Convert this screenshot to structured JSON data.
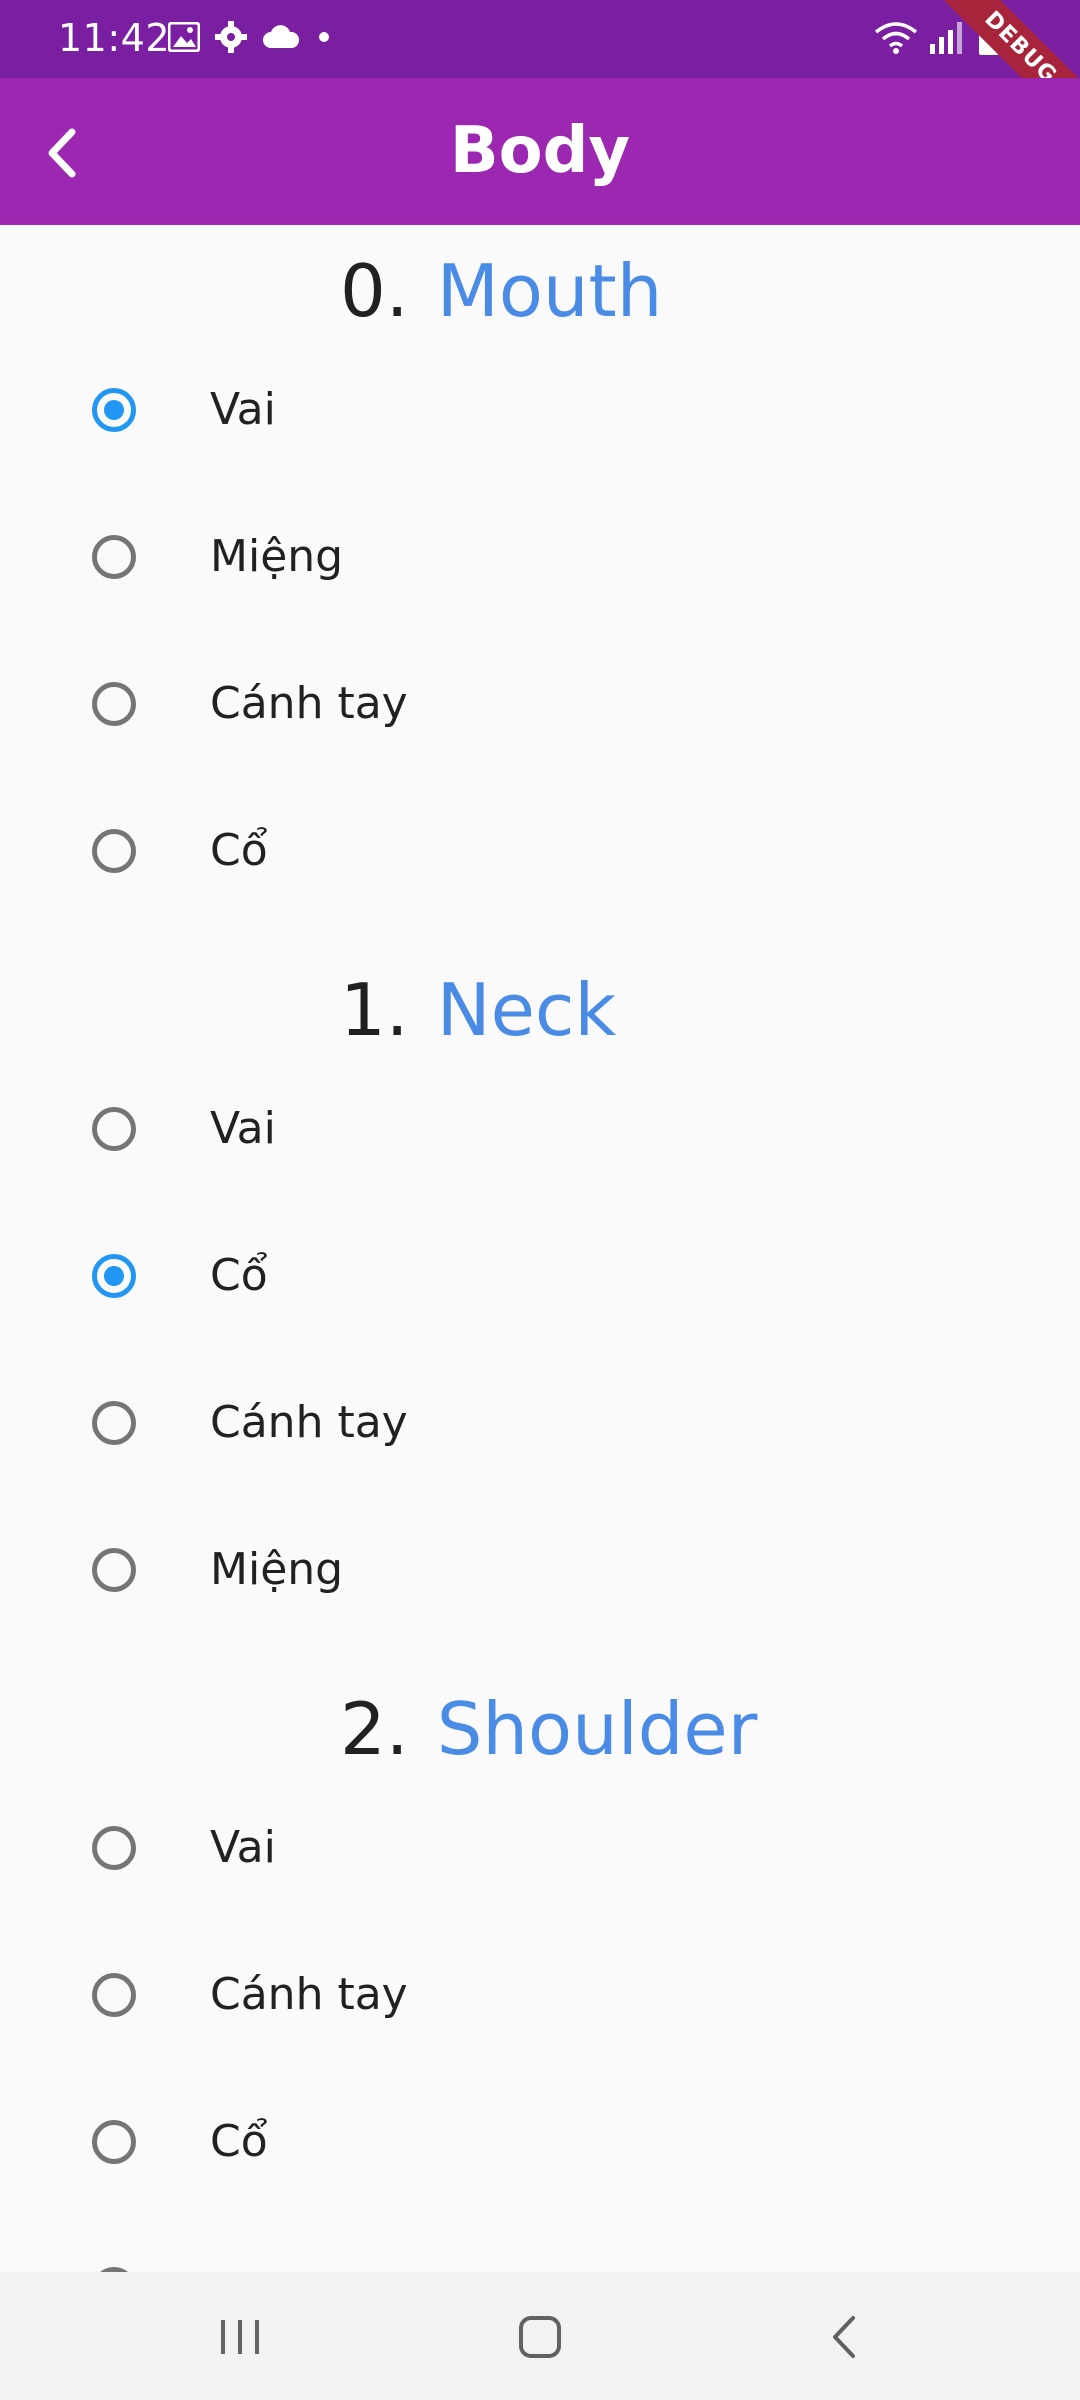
{
  "status_bar": {
    "time": "11:42",
    "left_icons": [
      "image-icon",
      "gear-icon",
      "cloud-icon",
      "dot-icon"
    ],
    "right_icons": [
      "wifi-icon",
      "signal-icon",
      "battery-icon"
    ],
    "debug_label": "DEBUG"
  },
  "app_bar": {
    "title": "Body",
    "back_icon": "back-arrow-icon"
  },
  "questions": [
    {
      "number": "0.",
      "word": "Mouth",
      "options": [
        {
          "label": "Vai",
          "selected": true
        },
        {
          "label": "Miệng",
          "selected": false
        },
        {
          "label": "Cánh tay",
          "selected": false
        },
        {
          "label": "Cổ",
          "selected": false
        }
      ]
    },
    {
      "number": "1.",
      "word": "Neck",
      "options": [
        {
          "label": "Vai",
          "selected": false
        },
        {
          "label": "Cổ",
          "selected": true
        },
        {
          "label": "Cánh tay",
          "selected": false
        },
        {
          "label": "Miệng",
          "selected": false
        }
      ]
    },
    {
      "number": "2.",
      "word": "Shoulder",
      "options": [
        {
          "label": "Vai",
          "selected": false
        },
        {
          "label": "Cánh tay",
          "selected": false
        },
        {
          "label": "Cổ",
          "selected": false
        },
        {
          "label": "",
          "selected": false
        }
      ]
    }
  ],
  "nav_bar": {
    "icons": [
      "recent-apps-icon",
      "home-icon",
      "back-icon"
    ]
  },
  "colors": {
    "status_bar": "#7b1fa2",
    "app_bar": "#9c27b0",
    "accent_blue": "#4a8be6",
    "radio_selected": "#2196f3"
  }
}
